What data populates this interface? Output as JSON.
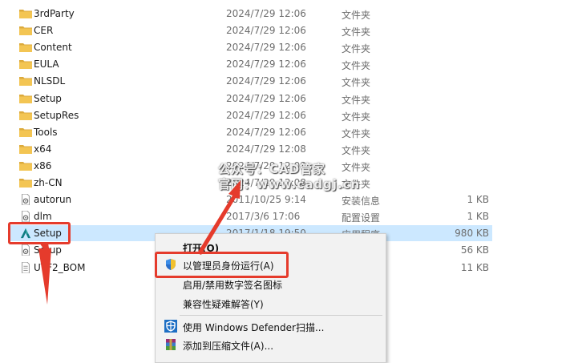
{
  "files": [
    {
      "name": "3rdParty",
      "date": "2024/7/29 12:06",
      "type": "文件夹",
      "size": "",
      "icon": "folder-icon"
    },
    {
      "name": "CER",
      "date": "2024/7/29 12:06",
      "type": "文件夹",
      "size": "",
      "icon": "folder-icon"
    },
    {
      "name": "Content",
      "date": "2024/7/29 12:06",
      "type": "文件夹",
      "size": "",
      "icon": "folder-icon"
    },
    {
      "name": "EULA",
      "date": "2024/7/29 12:06",
      "type": "文件夹",
      "size": "",
      "icon": "folder-icon"
    },
    {
      "name": "NLSDL",
      "date": "2024/7/29 12:06",
      "type": "文件夹",
      "size": "",
      "icon": "folder-icon"
    },
    {
      "name": "Setup",
      "date": "2024/7/29 12:06",
      "type": "文件夹",
      "size": "",
      "icon": "folder-icon"
    },
    {
      "name": "SetupRes",
      "date": "2024/7/29 12:06",
      "type": "文件夹",
      "size": "",
      "icon": "folder-icon"
    },
    {
      "name": "Tools",
      "date": "2024/7/29 12:06",
      "type": "文件夹",
      "size": "",
      "icon": "folder-icon"
    },
    {
      "name": "x64",
      "date": "2024/7/29 12:08",
      "type": "文件夹",
      "size": "",
      "icon": "folder-icon"
    },
    {
      "name": "x86",
      "date": "2024/7/29 12:08",
      "type": "文件夹",
      "size": "",
      "icon": "folder-icon"
    },
    {
      "name": "zh-CN",
      "date": "2024/7/29 12:08",
      "type": "文件夹",
      "size": "",
      "icon": "folder-icon"
    },
    {
      "name": "autorun",
      "date": "2011/10/25 9:14",
      "type": "安装信息",
      "size": "1 KB",
      "icon": "settings-file-icon"
    },
    {
      "name": "dlm",
      "date": "2017/3/6 17:06",
      "type": "配置设置",
      "size": "1 KB",
      "icon": "settings-file-icon"
    },
    {
      "name": "Setup",
      "date": "2017/1/18 19:50",
      "type": "应用程序",
      "size": "980 KB",
      "icon": "autodesk-app-icon",
      "selected": true
    },
    {
      "name": "Setup",
      "date": "",
      "type": "",
      "size": "56 KB",
      "icon": "settings-file-icon"
    },
    {
      "name": "UTF2_BOM",
      "date": "",
      "type": "",
      "size": "11 KB",
      "icon": "text-file-icon"
    }
  ],
  "context_menu": {
    "open": "打开(O)",
    "run_as_admin": "以管理员身份运行(A)",
    "signature_icon": "启用/禁用数字签名图标",
    "compat": "兼容性疑难解答(Y)",
    "defender": "使用 Windows Defender扫描...",
    "add_archive": "添加到压缩文件(A)..."
  },
  "watermark": {
    "line1": "公众号：CAD管家",
    "line2": "官网：www.cadgj.cn"
  },
  "colors": {
    "highlight_red": "#e53b2c",
    "selection_blue": "#cce8ff",
    "folder_yellow": "#f3c553"
  }
}
